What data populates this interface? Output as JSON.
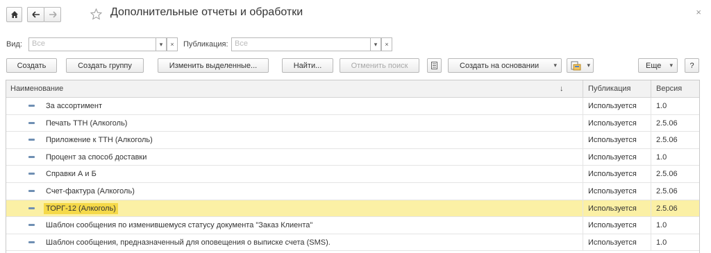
{
  "header": {
    "title": "Дополнительные отчеты и обработки",
    "home_icon": "home-icon",
    "back_icon": "back-arrow-icon",
    "forward_icon": "forward-arrow-icon",
    "star_icon": "star-icon",
    "close_glyph": "×"
  },
  "filters": {
    "view_label": "Вид:",
    "view_value": "Все",
    "publication_label": "Публикация:",
    "publication_value": "Все",
    "dropdown_glyph": "▾",
    "clear_glyph": "×"
  },
  "toolbar": {
    "create": "Создать",
    "create_group": "Создать группу",
    "edit_selected": "Изменить выделенные...",
    "find": "Найти...",
    "cancel_search": "Отменить поиск",
    "create_based_on": "Создать на основании",
    "more": "Еще",
    "help": "?"
  },
  "table": {
    "columns": [
      "Наименование",
      "Публикация",
      "Версия"
    ],
    "sort_indicator": "↓",
    "rows": [
      {
        "name": "За ассортимент",
        "publication": "Используется",
        "version": "1.0"
      },
      {
        "name": "Печать ТТН (Алкоголь)",
        "publication": "Используется",
        "version": "2.5.06"
      },
      {
        "name": "Приложение к ТТН  (Алкоголь)",
        "publication": "Используется",
        "version": "2.5.06"
      },
      {
        "name": "Процент за способ доставки",
        "publication": "Используется",
        "version": "1.0"
      },
      {
        "name": "Справки А и Б",
        "publication": "Используется",
        "version": "2.5.06"
      },
      {
        "name": "Счет-фактура (Алкоголь)",
        "publication": "Используется",
        "version": "2.5.06"
      },
      {
        "name": "ТОРГ-12 (Алкоголь)",
        "publication": "Используется",
        "version": "2.5.06",
        "selected": true
      },
      {
        "name": "Шаблон сообщения по изменившемуся статусу документа \"Заказ Клиента\"",
        "publication": "Используется",
        "version": "1.0"
      },
      {
        "name": "Шаблон сообщения, предназначенный для оповещения о выписке счета (SMS).",
        "publication": "Используется",
        "version": "1.0"
      }
    ]
  }
}
